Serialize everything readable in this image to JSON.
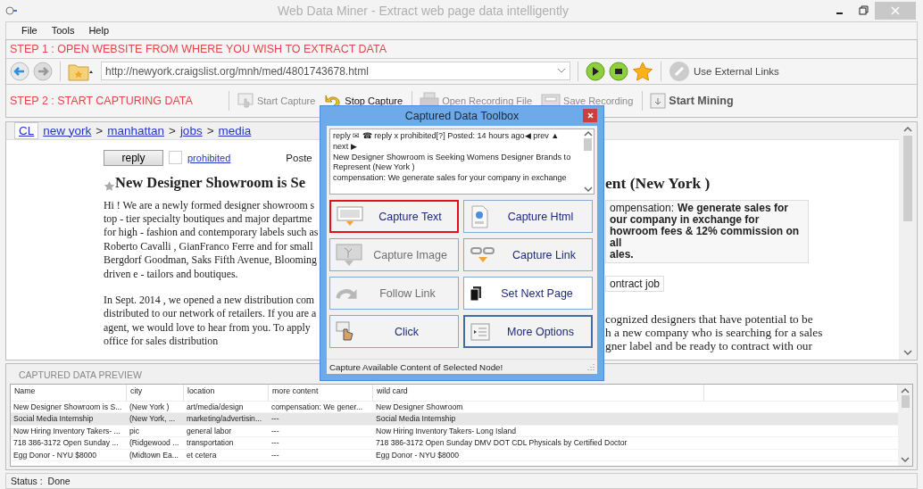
{
  "window": {
    "title": "Web Data Miner -  Extract web page data intelligently"
  },
  "menu": [
    "File",
    "Tools",
    "Help"
  ],
  "step1": {
    "label": "STEP 1 : OPEN WEBSITE FROM WHERE YOU WISH TO EXTRACT DATA",
    "url": "http://newyork.craigslist.org/mnh/med/4801743678.html",
    "external_links": "Use External Links"
  },
  "step2": {
    "label": "STEP 2 : START CAPTURING DATA",
    "actions": [
      {
        "label": "Start Capture",
        "kind": "start",
        "disabled": true
      },
      {
        "label": "Stop Capture",
        "kind": "stop",
        "disabled": false
      },
      {
        "label": "Open Recording File",
        "kind": "open",
        "disabled": true
      },
      {
        "label": "Save Recording",
        "kind": "save",
        "disabled": true
      },
      {
        "label": "Start Mining",
        "kind": "mine",
        "disabled": false
      }
    ]
  },
  "browser": {
    "home": "CL",
    "crumbs": [
      {
        "text": "new york",
        "kind": "link"
      },
      {
        "text": ">",
        "kind": "separator"
      },
      {
        "text": "manhattan",
        "kind": "link"
      },
      {
        "text": ">",
        "kind": "separator"
      },
      {
        "text": "jobs",
        "kind": "link"
      },
      {
        "text": ">",
        "kind": "separator"
      },
      {
        "text": "media",
        "kind": "link"
      }
    ],
    "reply": "reply",
    "checked": false,
    "prohibited": "prohibited",
    "posted": "Poste",
    "title_left": "New Designer Showroom is Se",
    "paragraphs_left": [
      [
        "Hi ! We are a newly formed designer showroom s",
        "top - tier specialty boutiques and major departme",
        "for high - fashion and contemporary labels such as",
        "Roberto Cavalli , GianFranco Ferre and for small",
        "Bergdorf Goodman, Saks Fifth Avenue, Blooming",
        "driven e - tailors and boutiques."
      ],
      [
        "In Sept. 2014 , we opened a new distribution com",
        "distributed to our network of retailers. If you are a",
        "agent, we would love to hear from you. To apply",
        "office for sales distribution"
      ]
    ],
    "title_right": "ent (New York )",
    "compensation": {
      "label": "ompensation:",
      "lines": [
        "We generate sales for",
        "our company in exchange for",
        "howroom fees & 12% commission on all",
        "ales."
      ]
    },
    "tag": "ontract job",
    "paragraph_right": [
      "cognized designers that have potential to be",
      "h a new company who is searching for a sales",
      "gner label and be ready to contract with our"
    ]
  },
  "preview": {
    "title": "CAPTURED DATA PREVIEW",
    "columns": [
      "Name",
      "city",
      "location",
      "more content",
      "wild card"
    ],
    "rows": [
      {
        "cells": [
          "New Designer Showroom is S...",
          "(New York )",
          "art/media/design",
          "compensation: We gener...",
          "New Designer Showroom"
        ],
        "selected": false
      },
      {
        "cells": [
          "Social Media Internship",
          "(New York, ...",
          "marketing/advertisin...",
          "---",
          "Social Media Internship"
        ],
        "selected": true
      },
      {
        "cells": [
          "Now Hiring Inventory Takers- ...",
          "pic",
          "general labor",
          "---",
          "Now Hiring Inventory Takers- Long Island"
        ],
        "selected": false
      },
      {
        "cells": [
          "718 386-3172 Open Sunday ...",
          "(Ridgewood ...",
          "transportation",
          "---",
          "718 386-3172 Open Sunday DMV DOT CDL Physicals by Certified Doctor"
        ],
        "selected": false
      },
      {
        "cells": [
          "Egg Donor - NYU $8000",
          "(Midtown Ea...",
          "et cetera",
          "---",
          "Egg Donor - NYU $8000"
        ],
        "selected": false
      }
    ]
  },
  "status": {
    "label": "Status :",
    "value": "Done"
  },
  "toolbox": {
    "title": "Captured Data Toolbox",
    "preview_lines": [
      "reply ✉ ☎ reply x prohibited[?] Posted: 14 hours ago◀ prev ▲",
      "next ▶",
      "New Designer Showroom is Seeking Womens Designer Brands to",
      "Represent (New York )",
      "compensation: We generate sales for your company in exchange"
    ],
    "buttons": [
      {
        "label": "Capture Text",
        "kind": "text",
        "selected": true,
        "disabled": false
      },
      {
        "label": "Capture Html",
        "kind": "html",
        "selected": false,
        "disabled": false
      },
      {
        "label": "Capture Image",
        "kind": "image",
        "selected": false,
        "disabled": true
      },
      {
        "label": "Capture Link",
        "kind": "link",
        "selected": false,
        "disabled": false
      },
      {
        "label": "Follow Link",
        "kind": "follow",
        "selected": false,
        "disabled": true
      },
      {
        "label": "Set Next Page",
        "kind": "next",
        "selected": false,
        "disabled": false
      },
      {
        "label": "Click",
        "kind": "click",
        "selected": false,
        "disabled": false
      },
      {
        "label": "More Options",
        "kind": "more",
        "selected": false,
        "disabled": false
      }
    ],
    "status": "Capture Available Content of Selected Node!"
  }
}
